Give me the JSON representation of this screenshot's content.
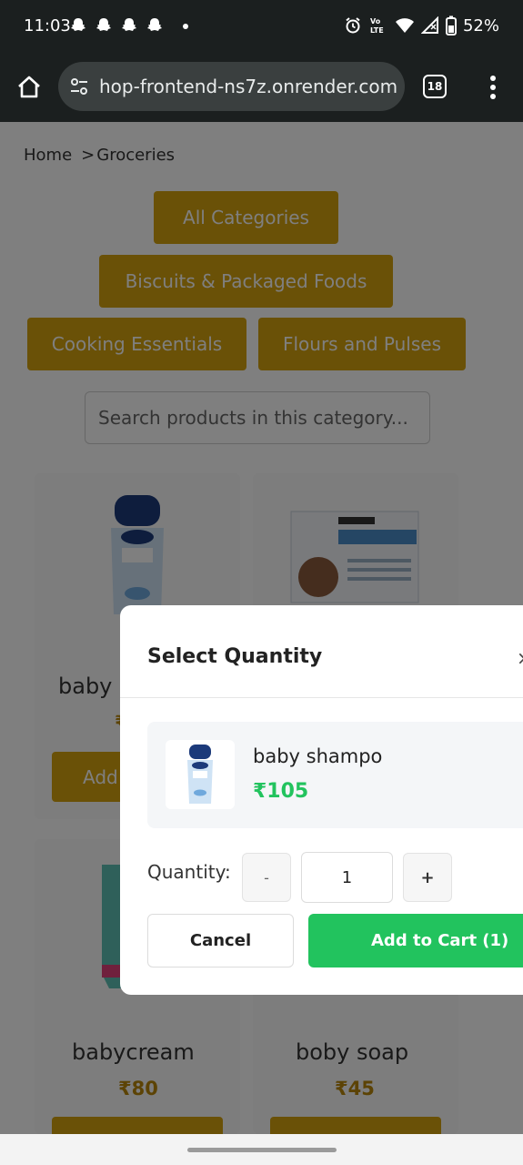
{
  "status_bar": {
    "time": "11:03",
    "notification_icons": [
      "snapchat-icon",
      "snapchat-icon",
      "snapchat-icon",
      "snapchat-icon"
    ],
    "network_label": "VoLTE",
    "battery": "52%"
  },
  "browser": {
    "url": "hop-frontend-ns7z.onrender.com",
    "tab_count": "18"
  },
  "breadcrumb": {
    "home": "Home",
    "separator": ">",
    "current": "Groceries"
  },
  "categories": [
    "All Categories",
    "Biscuits & Packaged Foods",
    "Cooking Essentials",
    "Flours and Pulses"
  ],
  "search": {
    "placeholder": "Search products in this category..."
  },
  "products": [
    {
      "name": "baby",
      "price": "₹",
      "button": "Add"
    },
    {
      "name": "",
      "price": "",
      "button": ""
    },
    {
      "name": "babycream",
      "price": "₹80",
      "button": ""
    },
    {
      "name": "boby soap",
      "price": "₹45",
      "button": ""
    }
  ],
  "modal": {
    "title": "Select Quantity",
    "close": "×",
    "product_name": "baby shampo",
    "product_price": "₹105",
    "quantity_label": "Quantity:",
    "minus": "-",
    "quantity": "1",
    "plus": "+",
    "cancel": "Cancel",
    "add_to_cart": "Add to Cart (1)"
  },
  "colors": {
    "accent": "#d4a20f",
    "success": "#22c35e",
    "price": "#b8860b"
  }
}
